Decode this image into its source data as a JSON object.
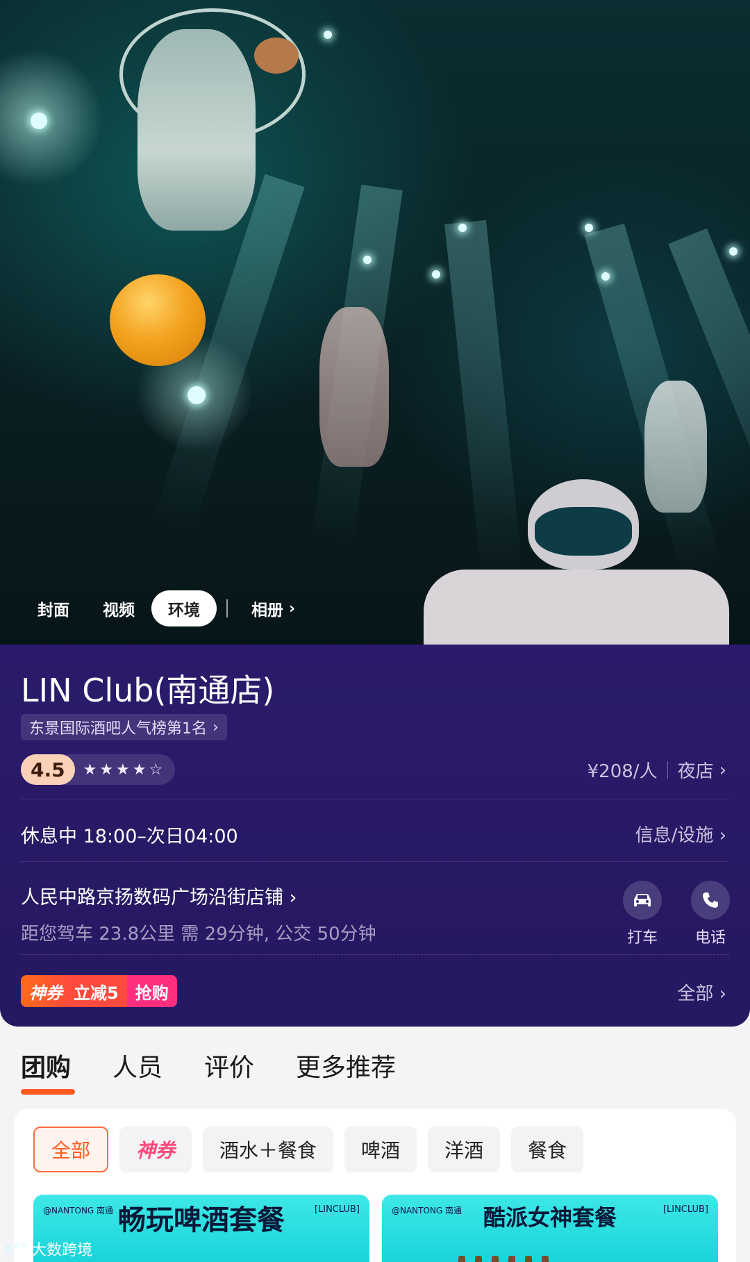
{
  "gallery": {
    "tabs": [
      "封面",
      "视频",
      "环境"
    ],
    "active_tab": "环境",
    "album_label": "相册"
  },
  "shop": {
    "name": "LIN Club(南通店)",
    "rank": "东景国际酒吧人气榜第1名",
    "rating": "4.5",
    "stars": "★★★★☆",
    "price": "¥208/人",
    "category": "夜店",
    "status_hours": "休息中 18:00–次日04:00",
    "facility_link": "信息/设施",
    "address": "人民中路京扬数码广场沿街店铺",
    "distance": "距您驾车 23.8公里 需 29分钟, 公交 50分钟",
    "actions": {
      "taxi": "打车",
      "phone": "电话"
    }
  },
  "coupon": {
    "label": "神券",
    "discount": "立减5",
    "cta": "抢购",
    "all_link": "全部"
  },
  "section_tabs": [
    "团购",
    "人员",
    "评价",
    "更多推荐"
  ],
  "filters": [
    "全部",
    "神券",
    "酒水＋餐食",
    "啤酒",
    "洋酒",
    "餐食"
  ],
  "deals": [
    {
      "title": "畅玩啤酒套餐",
      "tag_left": "@NANTONG 南通",
      "tag_right": "[LINCLUB]"
    },
    {
      "title": "酷派女神套餐",
      "tag_left": "@NANTONG 南通",
      "tag_right": "[LINCLUB]"
    }
  ],
  "watermark": "大数跨境",
  "colors": {
    "info_bg": "#2b1a6b",
    "accent": "#ff5a1e",
    "coupon_pink": "#ff2e7e",
    "thumb_cyan": "#3ee8e6"
  }
}
